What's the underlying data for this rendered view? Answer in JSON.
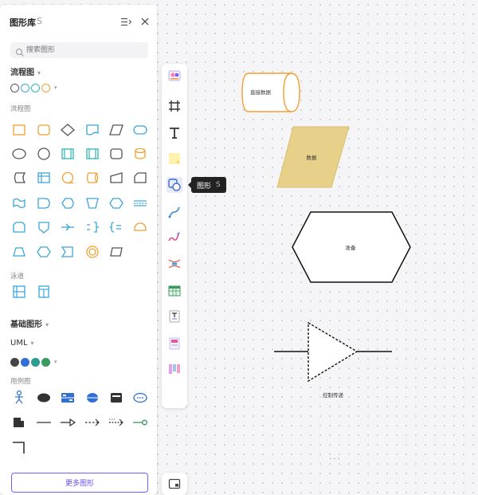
{
  "panel": {
    "title": "图形库",
    "shortcut": "S",
    "search_placeholder": "搜索图形",
    "more_button": "更多图形",
    "sections": {
      "flowchart": {
        "title": "流程图",
        "subtitle": "流程图",
        "swatches": [
          "#555555",
          "#3aa6d8",
          "#2fb5b0",
          "#f0a030"
        ]
      },
      "swimlane": {
        "subtitle": "泳道"
      },
      "basic": {
        "title": "基础图形"
      },
      "uml": {
        "title": "UML",
        "subtitle": "用例图",
        "swatches": [
          "#444444",
          "#2f6fd6",
          "#2b9e8f",
          "#3a9a5e"
        ]
      }
    }
  },
  "toolbar": {
    "tooltip_label": "图形",
    "tooltip_key": "S",
    "more": "···"
  },
  "canvas": {
    "cylinder_label": "直接数据",
    "parallelogram_label": "数据",
    "hexagon_label": "准备",
    "triangle_label": "控制传递"
  },
  "colors": {
    "accent": "#7c5cff",
    "flow_orange": "#f0a030",
    "flow_blue": "#3aa6d8",
    "data_fill": "#e6d08a"
  }
}
